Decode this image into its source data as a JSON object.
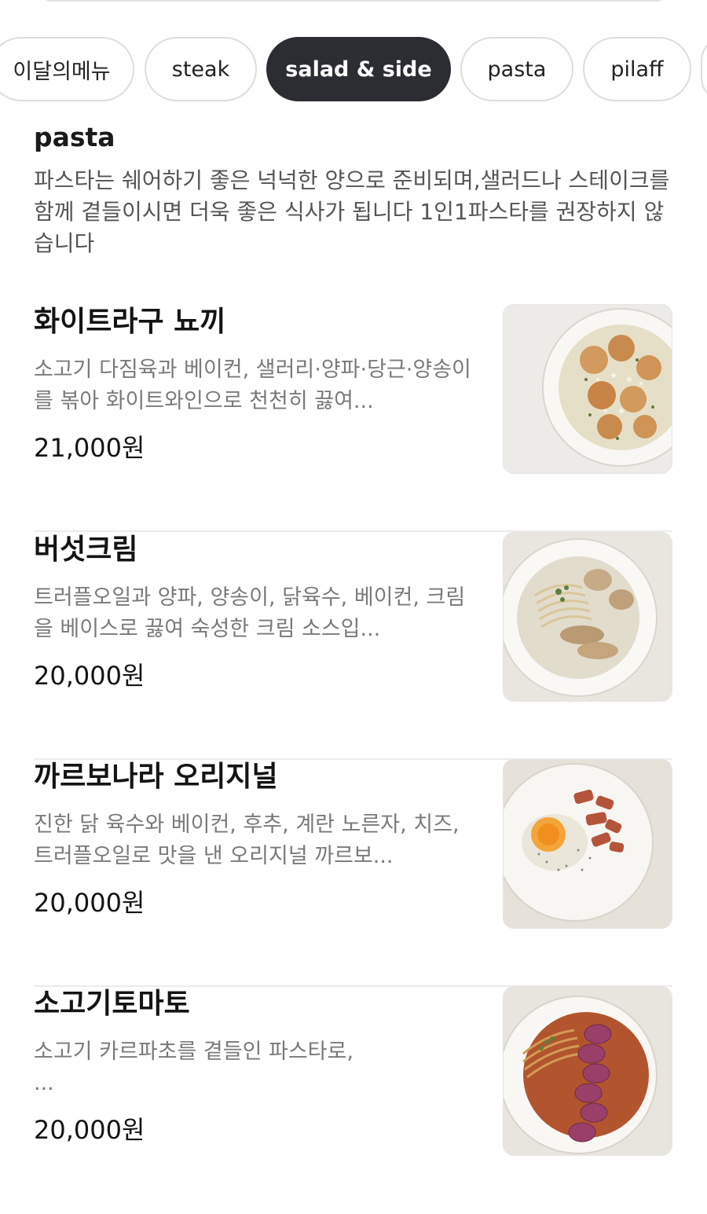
{
  "tabs": [
    {
      "label": "이달의메뉴",
      "active": false
    },
    {
      "label": "steak",
      "active": false
    },
    {
      "label": "salad & side",
      "active": true
    },
    {
      "label": "pasta",
      "active": false
    },
    {
      "label": "pilaff",
      "active": false
    }
  ],
  "section": {
    "title": "pasta",
    "description": "파스타는 쉐어하기 좋은 넉넉한 양으로 준비되며,샐러드나 스테이크를 함께 곁들이시면 더욱 좋은 식사가 됩니다 1인1파스타를 권장하지 않습니다"
  },
  "items": [
    {
      "name": "화이트라구 뇨끼",
      "description": "소고기 다짐육과 베이컨, 샐러리·양파·당근·양송이를  볶아 화이트와인으로 천천히 끓여...",
      "price": "21,000원",
      "image_icon": "gnocchi-photo"
    },
    {
      "name": "버섯크림",
      "description": "트러플오일과 양파, 양송이, 닭육수, 베이컨, 크림을 베이스로 끓여 숙성한 크림 소스입...",
      "price": "20,000원",
      "image_icon": "mushroom-cream-pasta-photo"
    },
    {
      "name": "까르보나라 오리지널",
      "description": "진한 닭 육수와 베이컨, 후추, 계란 노른자, 치즈, 트러플오일로 맛을 낸 오리지널 까르보...",
      "price": "20,000원",
      "image_icon": "carbonara-photo"
    },
    {
      "name": "소고기토마토",
      "description": "소고기 카르파초를 곁들인 파스타로,\n ...",
      "price": "20,000원",
      "image_icon": "beef-tomato-pasta-photo"
    }
  ],
  "colors": {
    "active_tab_bg": "#2b2d33",
    "text_primary": "#141414",
    "text_secondary": "#7a7a7a",
    "divider": "#ececec"
  }
}
